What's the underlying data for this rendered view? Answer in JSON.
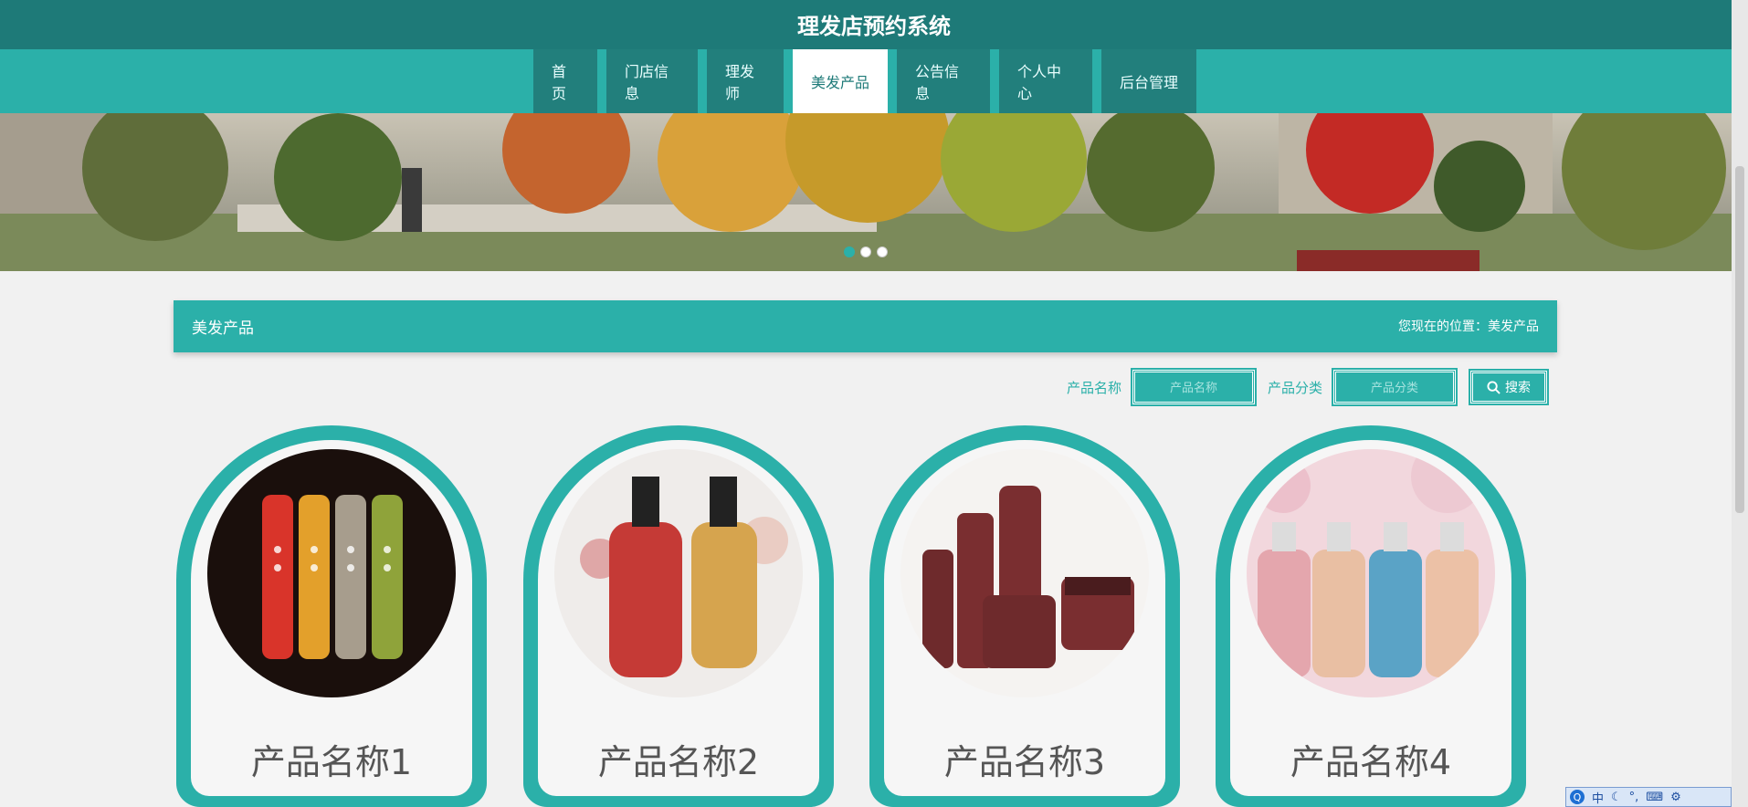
{
  "header": {
    "title": "理发店预约系统"
  },
  "nav": {
    "items": [
      {
        "label": "首页"
      },
      {
        "label": "门店信息"
      },
      {
        "label": "理发师"
      },
      {
        "label": "美发产品",
        "active": true
      },
      {
        "label": "公告信息"
      },
      {
        "label": "个人中心"
      },
      {
        "label": "后台管理"
      }
    ]
  },
  "banner": {
    "slide_count": 3,
    "active_slide": 1
  },
  "section": {
    "title": "美发产品",
    "breadcrumb": "您现在的位置：美发产品"
  },
  "search": {
    "name_label": "产品名称",
    "name_placeholder": "产品名称",
    "category_label": "产品分类",
    "category_placeholder": "产品分类",
    "button_label": "搜索"
  },
  "products": [
    {
      "name": "产品名称1"
    },
    {
      "name": "产品名称2"
    },
    {
      "name": "产品名称3"
    },
    {
      "name": "产品名称4"
    }
  ],
  "ime": {
    "mode": "中"
  },
  "colors": {
    "primary": "#2bb0a9",
    "dark": "#1e7a78",
    "nav_item": "#227f7c"
  }
}
